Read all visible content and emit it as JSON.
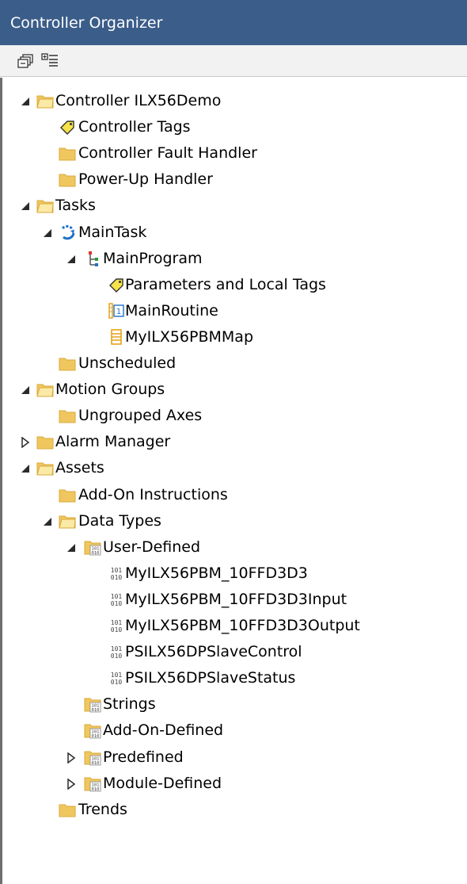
{
  "panel": {
    "title": "Controller Organizer"
  },
  "toolbar": [
    {
      "name": "collapse-all-button",
      "icon": "collapse-all-icon"
    },
    {
      "name": "expand-all-button",
      "icon": "expand-all-icon"
    }
  ],
  "colors": {
    "title_bg": "#3b5d8a",
    "folder": "#f0c75e",
    "folder_dark": "#d9a93a",
    "toggle": "#2b2b2b",
    "task_blue": "#1e73c8",
    "border": "#6f6f6f"
  },
  "tree": [
    {
      "label": "Controller ILX56Demo",
      "icon": "folder-open-icon",
      "toggle": "expanded",
      "level": 0
    },
    {
      "label": "Controller Tags",
      "icon": "tag-icon",
      "toggle": "none",
      "level": 1
    },
    {
      "label": "Controller Fault Handler",
      "icon": "folder-icon",
      "toggle": "none",
      "level": 1
    },
    {
      "label": "Power-Up Handler",
      "icon": "folder-icon",
      "toggle": "none",
      "level": 1
    },
    {
      "label": "Tasks",
      "icon": "folder-open-icon",
      "toggle": "expanded",
      "level": 0
    },
    {
      "label": "MainTask",
      "icon": "task-icon",
      "toggle": "expanded",
      "level": 1
    },
    {
      "label": "MainProgram",
      "icon": "program-icon",
      "toggle": "expanded",
      "level": 2
    },
    {
      "label": "Parameters and Local Tags",
      "icon": "tag-icon",
      "toggle": "none",
      "level": 3
    },
    {
      "label": "MainRoutine",
      "icon": "main-routine-icon",
      "toggle": "none",
      "level": 3
    },
    {
      "label": "MyILX56PBMMap",
      "icon": "routine-icon",
      "toggle": "none",
      "level": 3
    },
    {
      "label": "Unscheduled",
      "icon": "folder-icon",
      "toggle": "none",
      "level": 1
    },
    {
      "label": "Motion Groups",
      "icon": "folder-open-icon",
      "toggle": "expanded",
      "level": 0
    },
    {
      "label": "Ungrouped Axes",
      "icon": "folder-icon",
      "toggle": "none",
      "level": 1
    },
    {
      "label": "Alarm Manager",
      "icon": "folder-icon",
      "toggle": "collapsed",
      "level": 0
    },
    {
      "label": "Assets",
      "icon": "folder-open-icon",
      "toggle": "expanded",
      "level": 0
    },
    {
      "label": "Add-On Instructions",
      "icon": "folder-icon",
      "toggle": "none",
      "level": 1
    },
    {
      "label": "Data Types",
      "icon": "folder-open-icon",
      "toggle": "expanded",
      "level": 1
    },
    {
      "label": "User-Defined",
      "icon": "data-type-folder-icon",
      "toggle": "expanded",
      "level": 2
    },
    {
      "label": "MyILX56PBM_10FFD3D3",
      "icon": "data-type-icon",
      "toggle": "none",
      "level": 3
    },
    {
      "label": "MyILX56PBM_10FFD3D3Input",
      "icon": "data-type-icon",
      "toggle": "none",
      "level": 3
    },
    {
      "label": "MyILX56PBM_10FFD3D3Output",
      "icon": "data-type-icon",
      "toggle": "none",
      "level": 3
    },
    {
      "label": "PSILX56DPSlaveControl",
      "icon": "data-type-icon",
      "toggle": "none",
      "level": 3
    },
    {
      "label": "PSILX56DPSlaveStatus",
      "icon": "data-type-icon",
      "toggle": "none",
      "level": 3
    },
    {
      "label": "Strings",
      "icon": "data-type-folder-icon",
      "toggle": "none",
      "level": 2
    },
    {
      "label": "Add-On-Defined",
      "icon": "data-type-folder-icon",
      "toggle": "none",
      "level": 2
    },
    {
      "label": "Predefined",
      "icon": "data-type-folder-icon",
      "toggle": "collapsed",
      "level": 2
    },
    {
      "label": "Module-Defined",
      "icon": "data-type-folder-icon",
      "toggle": "collapsed",
      "level": 2
    },
    {
      "label": "Trends",
      "icon": "folder-icon",
      "toggle": "none",
      "level": 1
    }
  ]
}
